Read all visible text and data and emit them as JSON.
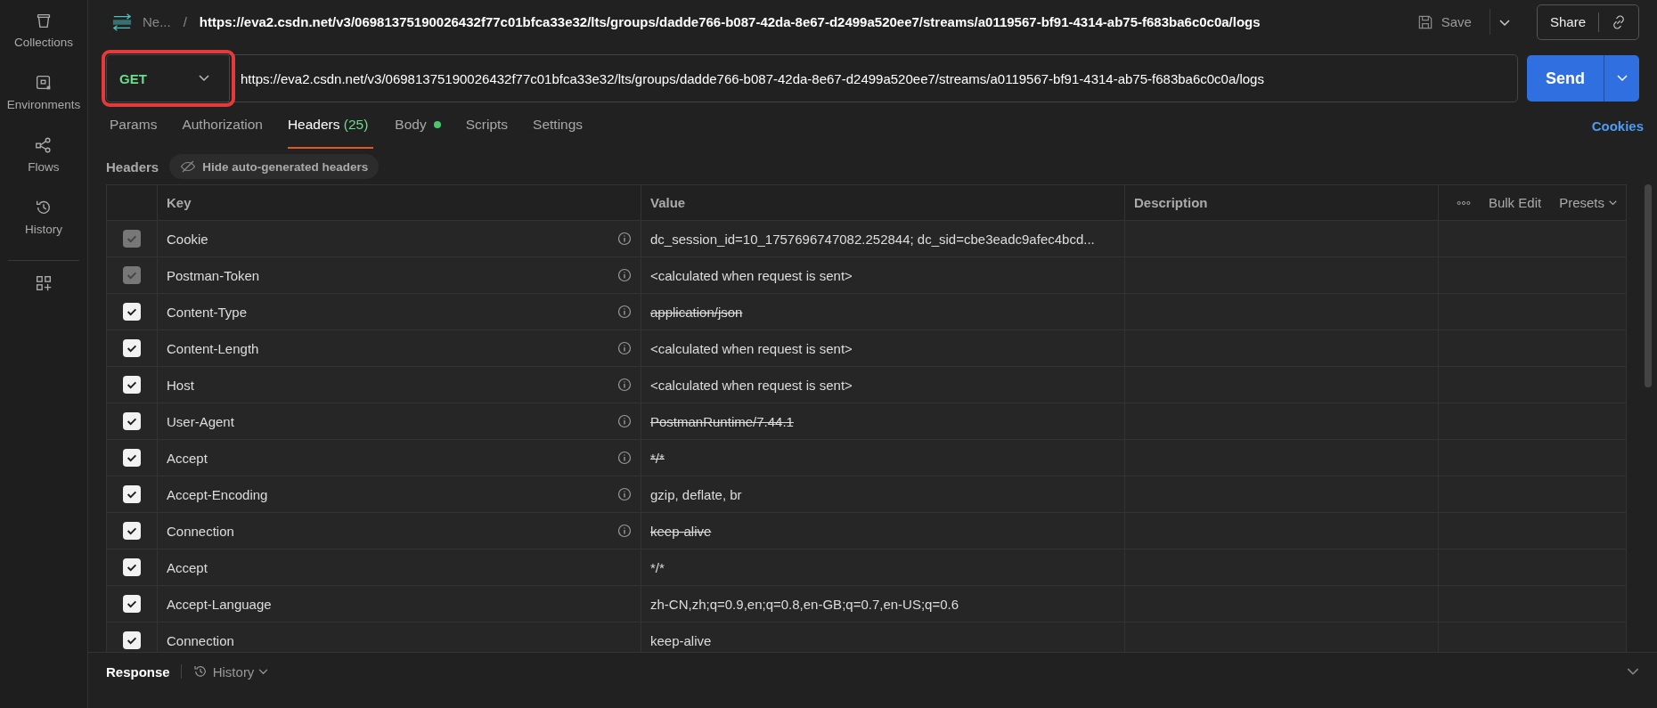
{
  "sidebar": {
    "items": [
      {
        "label": "Collections"
      },
      {
        "label": "Environments"
      },
      {
        "label": "Flows"
      },
      {
        "label": "History"
      }
    ]
  },
  "topbar": {
    "tab_name": "Ne...",
    "separator": "/",
    "title": "https://eva2.csdn.net/v3/06981375190026432f77c01bfca33e32/lts/groups/dadde766-b087-42da-8e67-d2499a520ee7/streams/a0119567-bf91-4314-ab75-f683ba6c0c0a/logs",
    "save": "Save",
    "share": "Share"
  },
  "request": {
    "method": "GET",
    "method_highlighted": true,
    "url": "https://eva2.csdn.net/v3/06981375190026432f77c01bfca33e32/lts/groups/dadde766-b087-42da-8e67-d2499a520ee7/streams/a0119567-bf91-4314-ab75-f683ba6c0c0a/logs",
    "send": "Send"
  },
  "tabs": [
    {
      "label": "Params",
      "selected": false
    },
    {
      "label": "Authorization",
      "selected": false
    },
    {
      "label": "Headers",
      "count": "(25)",
      "selected": true
    },
    {
      "label": "Body",
      "dot": true,
      "selected": false
    },
    {
      "label": "Scripts",
      "selected": false
    },
    {
      "label": "Settings",
      "selected": false
    }
  ],
  "cookies": "Cookies",
  "headers_bar": {
    "title": "Headers",
    "toggle": "Hide auto-generated headers"
  },
  "table": {
    "columns": [
      "Key",
      "Value",
      "Description"
    ],
    "bulk_edit": "Bulk Edit",
    "presets": "Presets",
    "rows": [
      {
        "key": "Cookie",
        "value": "dc_session_id=10_1757696747082.252844; dc_sid=cbe3eadc9afec4bcd...",
        "checked": true,
        "disabled": true,
        "info": true,
        "overridden": false
      },
      {
        "key": "Postman-Token",
        "value": "<calculated when request is sent>",
        "checked": true,
        "disabled": true,
        "info": true,
        "overridden": false
      },
      {
        "key": "Content-Type",
        "value": "application/json",
        "checked": true,
        "disabled": false,
        "info": true,
        "overridden": true
      },
      {
        "key": "Content-Length",
        "value": "<calculated when request is sent>",
        "checked": true,
        "disabled": false,
        "info": true,
        "overridden": false
      },
      {
        "key": "Host",
        "value": "<calculated when request is sent>",
        "checked": true,
        "disabled": false,
        "info": true,
        "overridden": false
      },
      {
        "key": "User-Agent",
        "value": "PostmanRuntime/7.44.1",
        "checked": true,
        "disabled": false,
        "info": true,
        "overridden": true
      },
      {
        "key": "Accept",
        "value": "*/*",
        "checked": true,
        "disabled": false,
        "info": true,
        "overridden": true
      },
      {
        "key": "Accept-Encoding",
        "value": "gzip, deflate, br",
        "checked": true,
        "disabled": false,
        "info": true,
        "overridden": false
      },
      {
        "key": "Connection",
        "value": "keep-alive",
        "checked": true,
        "disabled": false,
        "info": true,
        "overridden": true
      },
      {
        "key": "Accept",
        "value": "*/*",
        "checked": true,
        "disabled": false,
        "info": false,
        "overridden": false
      },
      {
        "key": "Accept-Language",
        "value": "zh-CN,zh;q=0.9,en;q=0.8,en-GB;q=0.7,en-US;q=0.6",
        "checked": true,
        "disabled": false,
        "info": false,
        "overridden": false
      },
      {
        "key": "Connection",
        "value": "keep-alive",
        "checked": true,
        "disabled": false,
        "info": false,
        "overridden": false
      }
    ]
  },
  "response": {
    "title": "Response",
    "history": "History"
  }
}
